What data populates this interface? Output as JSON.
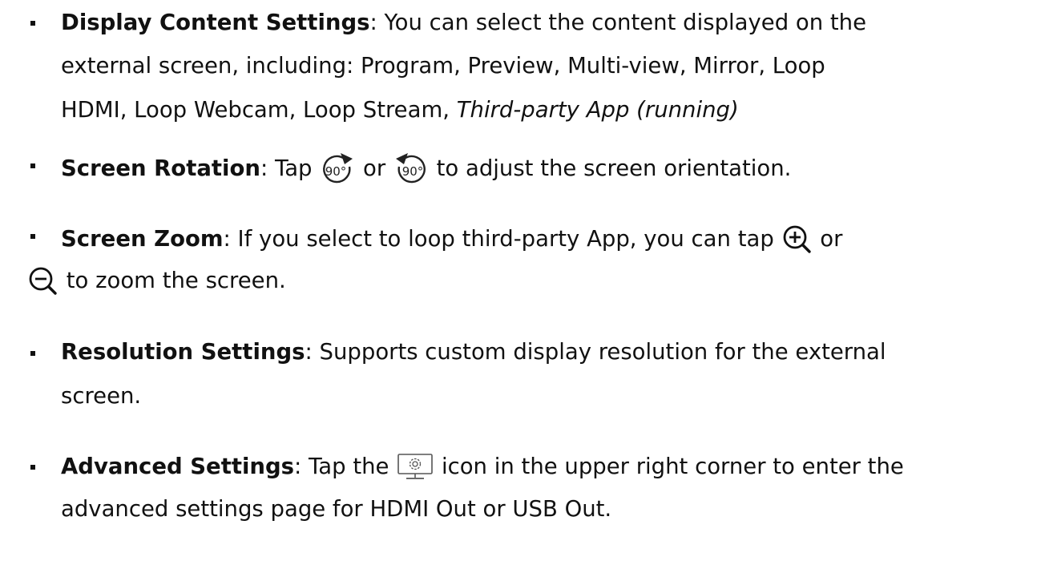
{
  "items": [
    {
      "term": "Display Content Settings",
      "text_1": ": You can select the content displayed on the",
      "text_2": "external screen, including: Program, Preview, Multi-view, Mirror, Loop",
      "text_3": "HDMI, Loop Webcam, Loop Stream, ",
      "text_3_italic": "Third-party App (running)"
    },
    {
      "term": "Screen Rotation",
      "text_1": ": Tap ",
      "icon_1": "rotate-clockwise-90-icon",
      "text_2": " or ",
      "icon_2": "rotate-counterclockwise-90-icon",
      "text_3": " to adjust the screen orientation.",
      "icon_label": "90°"
    },
    {
      "term": "Screen Zoom",
      "text_1": ": If you select to loop third-party App, you can tap ",
      "icon_1": "zoom-in-icon",
      "text_2": " or",
      "icon_2": "zoom-out-icon",
      "text_3": " to zoom the screen."
    },
    {
      "term": "Resolution Settings",
      "text_1": ": Supports custom display resolution for the external",
      "text_2": "screen."
    },
    {
      "term": "Advanced Settings",
      "text_1": ": Tap the ",
      "icon_1": "display-settings-icon",
      "text_2": " icon in the upper right corner to enter the",
      "text_3": "advanced settings page for HDMI Out or USB Out."
    }
  ]
}
